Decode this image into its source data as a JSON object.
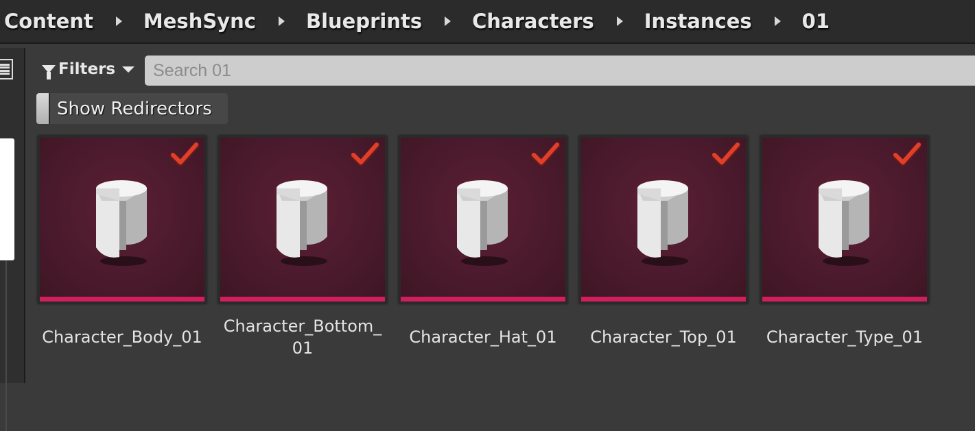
{
  "breadcrumb": [
    "Content",
    "MeshSync",
    "Blueprints",
    "Characters",
    "Instances",
    "01"
  ],
  "filters": {
    "label": "Filters",
    "icon": "funnel-icon"
  },
  "search": {
    "placeholder": "Search 01",
    "value": ""
  },
  "redirectors": {
    "label": "Show Redirectors",
    "checked": false
  },
  "colors": {
    "asset_bar": "#d11e5c",
    "thumb_bg": "#4a1a2c",
    "check": "#e0402a"
  },
  "assets": [
    {
      "name_line1": "Character_Body_01",
      "name_line2": ""
    },
    {
      "name_line1": "Character_Bottom_",
      "name_line2": "01"
    },
    {
      "name_line1": "Character_Hat_01",
      "name_line2": ""
    },
    {
      "name_line1": "Character_Top_01",
      "name_line2": ""
    },
    {
      "name_line1": "Character_Type_01",
      "name_line2": ""
    }
  ]
}
